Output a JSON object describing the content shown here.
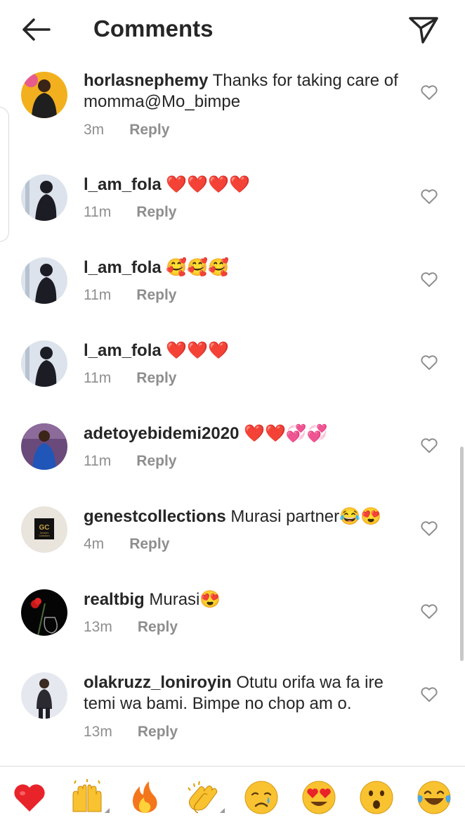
{
  "header": {
    "title": "Comments"
  },
  "comments": [
    {
      "username": "horlasnephemy",
      "text": "Thanks for taking care of momma@Mo_bimpe",
      "time": "3m",
      "reply": "Reply"
    },
    {
      "username": "l_am_fola",
      "text": "❤️❤️❤️❤️",
      "time": "11m",
      "reply": "Reply"
    },
    {
      "username": "l_am_fola",
      "text": "🥰🥰🥰",
      "time": "11m",
      "reply": "Reply"
    },
    {
      "username": "l_am_fola",
      "text": "❤️❤️❤️",
      "time": "11m",
      "reply": "Reply"
    },
    {
      "username": "adetoyebidemi2020",
      "text": "❤️❤️💞💞",
      "time": "11m",
      "reply": "Reply"
    },
    {
      "username": "genestcollections",
      "text": "Murasi partner😂😍",
      "time": "4m",
      "reply": "Reply"
    },
    {
      "username": "realtbig",
      "text": "Murasi😍",
      "time": "13m",
      "reply": "Reply"
    },
    {
      "username": "olakruzz_loniroyin",
      "text": "Otutu orifa wa fa ire temi wa bami. Bimpe no chop am o.",
      "time": "13m",
      "reply": "Reply"
    }
  ],
  "avatars": {
    "horlasnephemy": "woman-in-black-dress-yellow-background",
    "l_am_fola": "figure-in-dark-outfit",
    "adetoyebidemi2020": "woman-in-blue-dress",
    "genestcollections": "gc-logo-avatar",
    "realtbig": "red-rose-dark-background",
    "olakruzz_loniroyin": "man-standing-pose"
  },
  "avatar_logo": {
    "mark": "GC",
    "line1": "Genest's",
    "line2": "Collections"
  },
  "icons": {
    "back": "arrow-left-icon",
    "send": "paper-plane-icon",
    "like": "heart-outline-icon"
  },
  "emoji_bar": [
    "red-heart",
    "raising-hands",
    "fire",
    "clapping-hands",
    "crying-face",
    "heart-eyes",
    "astonished-face",
    "tears-of-joy"
  ],
  "colors": {
    "text": "#262626",
    "meta": "#8e8e8e",
    "divider": "#dbdbdb",
    "heart": "#ed1c24"
  }
}
